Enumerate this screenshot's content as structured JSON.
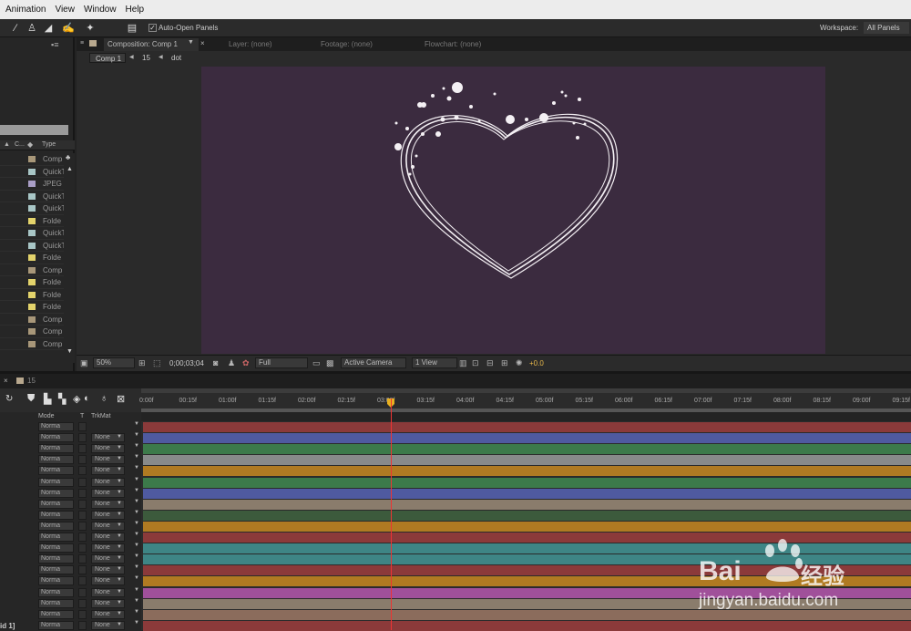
{
  "menu": [
    "Animation",
    "View",
    "Window",
    "Help"
  ],
  "toolbar": {
    "auto_open": "Auto-Open Panels",
    "workspace_label": "Workspace:",
    "workspace_value": "All Panels"
  },
  "project": {
    "cols": [
      "C...",
      "Type"
    ],
    "items": [
      {
        "type": "Comp",
        "color": "#a89779"
      },
      {
        "type": "QuickT",
        "color": "#a8c6c6"
      },
      {
        "type": "JPEG",
        "color": "#a99ec6"
      },
      {
        "type": "QuickT",
        "color": "#a8c6c6"
      },
      {
        "type": "QuickT",
        "color": "#a8c6c6"
      },
      {
        "type": "Folde",
        "color": "#e3d36b"
      },
      {
        "type": "QuickT",
        "color": "#a8c6c6"
      },
      {
        "type": "QuickT",
        "color": "#a8c6c6"
      },
      {
        "type": "Folde",
        "color": "#e3d36b"
      },
      {
        "type": "Comp",
        "color": "#a89779"
      },
      {
        "type": "Folde",
        "color": "#e3d36b"
      },
      {
        "type": "Folde",
        "color": "#e3d36b"
      },
      {
        "type": "Folde",
        "color": "#e3d36b"
      },
      {
        "type": "Comp",
        "color": "#a89779"
      },
      {
        "type": "Comp",
        "color": "#a89779"
      },
      {
        "type": "Comp",
        "color": "#a89779"
      }
    ]
  },
  "tabs": {
    "composition": "Composition: Comp 1",
    "layer": "Layer: (none)",
    "footage": "Footage: (none)",
    "flowchart": "Flowchart: (none)"
  },
  "breadcrumb": [
    "Comp 1",
    "15",
    "dot"
  ],
  "viewer_footer": {
    "zoom": "50%",
    "timecode": "0;00;03;04",
    "resolution": "Full",
    "camera": "Active Camera",
    "views": "1 View",
    "exposure": "+0.0"
  },
  "timeline": {
    "tab": "15",
    "col_mode": "Mode",
    "col_t": "T",
    "col_trkmat": "TrkMat",
    "ticks": [
      "0:00f",
      "00:15f",
      "01:00f",
      "01:15f",
      "02:00f",
      "02:15f",
      "03:00f",
      "03:15f",
      "04:00f",
      "04:15f",
      "05:00f",
      "05:15f",
      "06:00f",
      "06:15f",
      "07:00f",
      "07:15f",
      "08:00f",
      "08:15f",
      "09:00f",
      "09:15f"
    ],
    "mode_label": "Norma",
    "trkmat_label": "None",
    "bottom_label": "id 1]",
    "layer_colors": [
      "#8b3a3a",
      "#4f5aa0",
      "#3c7a4a",
      "#888a8a",
      "#b07a22",
      "#3c7a4a",
      "#4f5aa0",
      "#8a7c6c",
      "#3c5a3c",
      "#b07a22",
      "#8b3a3a",
      "#3e8585",
      "#3e8585",
      "#8b3a3a",
      "#b07a22",
      "#a0509a",
      "#8a7c6c",
      "#8b6c5c",
      "#8b3a3a"
    ]
  },
  "watermark": {
    "brand": "Bai",
    "suffix": "经验",
    "url": "jingyan.baidu.com"
  }
}
